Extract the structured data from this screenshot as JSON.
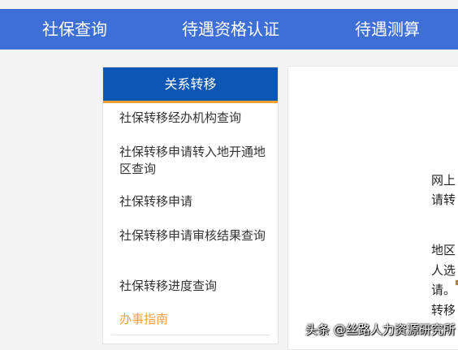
{
  "topnav": {
    "items": [
      {
        "label": "社保查询"
      },
      {
        "label": "待遇资格认证"
      },
      {
        "label": "待遇测算"
      }
    ]
  },
  "sidebar": {
    "title": "关系转移",
    "items": [
      {
        "label": "社保转移经办机构查询"
      },
      {
        "label": "社保转移申请转入地开通地区查询"
      },
      {
        "label": "社保转移申请"
      },
      {
        "label": "社保转移申请审核结果查询"
      },
      {
        "label": "社保转移进度查询"
      },
      {
        "label": "办事指南"
      }
    ]
  },
  "content": {
    "lines": [
      "网上",
      "请转",
      "地区",
      "人选",
      "请。",
      "转移"
    ]
  },
  "watermark": "头条 @丝路人力资源研究所"
}
